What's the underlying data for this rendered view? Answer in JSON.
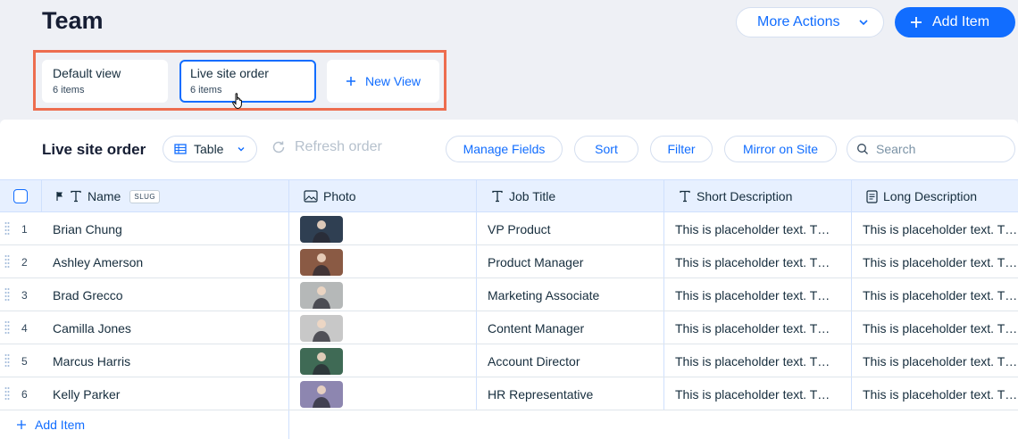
{
  "page": {
    "title": "Team",
    "more_actions": "More Actions",
    "add_item": "Add Item"
  },
  "views": [
    {
      "name": "Default view",
      "count": "6 items"
    },
    {
      "name": "Live site order",
      "count": "6 items"
    }
  ],
  "new_view": "New View",
  "toolbar": {
    "title": "Live site order",
    "layout_select": "Table",
    "refresh": "Refresh order",
    "manage_fields": "Manage Fields",
    "sort": "Sort",
    "filter": "Filter",
    "mirror": "Mirror on Site",
    "search_placeholder": "Search"
  },
  "columns": {
    "name": "Name",
    "slug_badge": "SLUG",
    "photo": "Photo",
    "job_title": "Job Title",
    "short_description": "Short Description",
    "long_description": "Long Description"
  },
  "rows": [
    {
      "num": "1",
      "name": "Brian Chung",
      "job": "VP Product",
      "short": "This is placeholder text. T…",
      "long": "This is placeholder text. T…"
    },
    {
      "num": "2",
      "name": "Ashley Amerson",
      "job": "Product Manager",
      "short": "This is placeholder text. T…",
      "long": "This is placeholder text. T…"
    },
    {
      "num": "3",
      "name": "Brad Grecco",
      "job": "Marketing Associate",
      "short": "This is placeholder text. T…",
      "long": "This is placeholder text. T…"
    },
    {
      "num": "4",
      "name": "Camilla Jones",
      "job": "Content Manager",
      "short": "This is placeholder text. T…",
      "long": "This is placeholder text. T…"
    },
    {
      "num": "5",
      "name": "Marcus Harris",
      "job": "Account Director",
      "short": "This is placeholder text. T…",
      "long": "This is placeholder text. T…"
    },
    {
      "num": "6",
      "name": "Kelly Parker",
      "job": "HR Representative",
      "short": "This is placeholder text. T…",
      "long": "This is placeholder text. T…"
    }
  ],
  "add_item_row": "Add Item",
  "colors": {
    "accent": "#116dff",
    "highlight": "#ed6d4f",
    "header_bg": "#e7f0ff",
    "photo_backgrounds": [
      "#2f3f52",
      "#8a5a44",
      "#b5b8b8",
      "#c8c8c8",
      "#3f6a55",
      "#8d86b0"
    ]
  }
}
